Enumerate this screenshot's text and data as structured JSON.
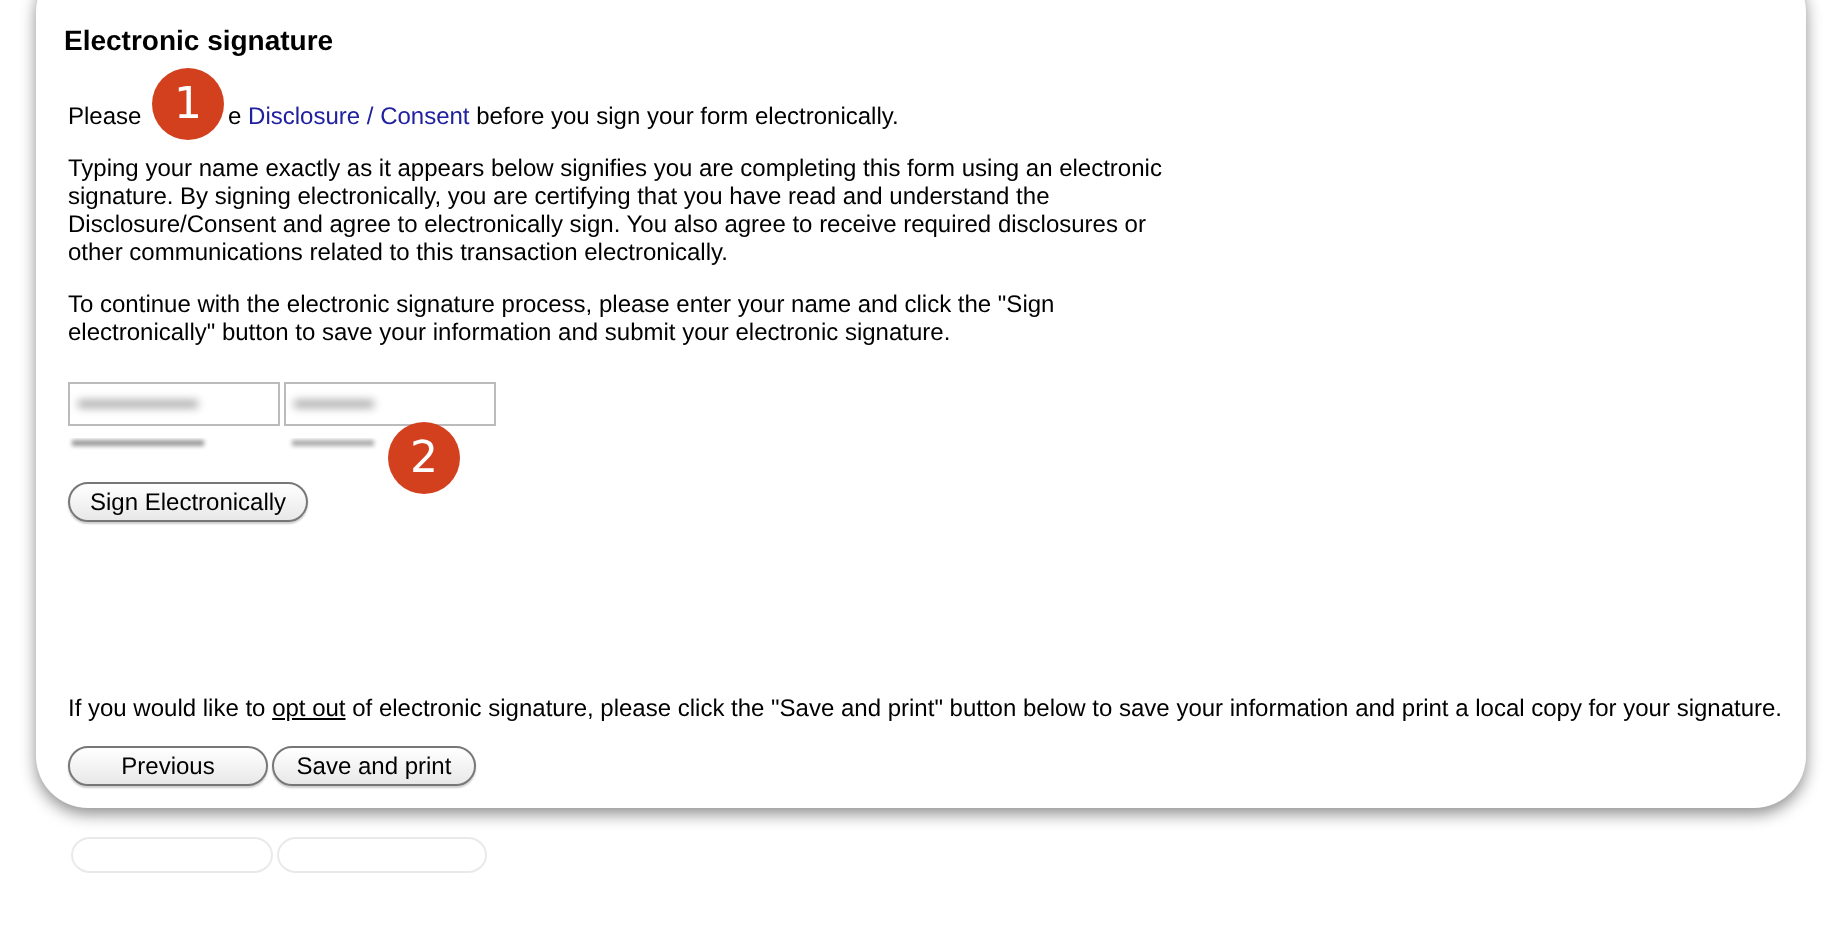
{
  "title": "Electronic signature",
  "intro": {
    "before": "Please",
    "after_badge": "e ",
    "link": "Disclosure / Consent",
    "after": " before you sign your form electronically."
  },
  "badges": [
    {
      "label": "1"
    },
    {
      "label": "2"
    }
  ],
  "paragraphs": [
    "Typing your name exactly as it appears below signifies you are completing this form using an electronic signature. By signing electronically, you are certifying that you have read and understand the Disclosure/Consent and agree to electronically sign. You also agree to receive required disclosures or other communications related to this transaction electronically.",
    "To continue with the electronic signature process, please enter your name and click the \"Sign electronically\" button to save your information and submit your electronic signature."
  ],
  "sign_button": "Sign Electronically",
  "opt_out": {
    "before": "If you would like to ",
    "link": "opt out",
    "after": " of electronic signature, please click the \"Save and print\" button below to save your information and print a local copy for your signature."
  },
  "buttons": [
    "Previous",
    "Save and print"
  ]
}
